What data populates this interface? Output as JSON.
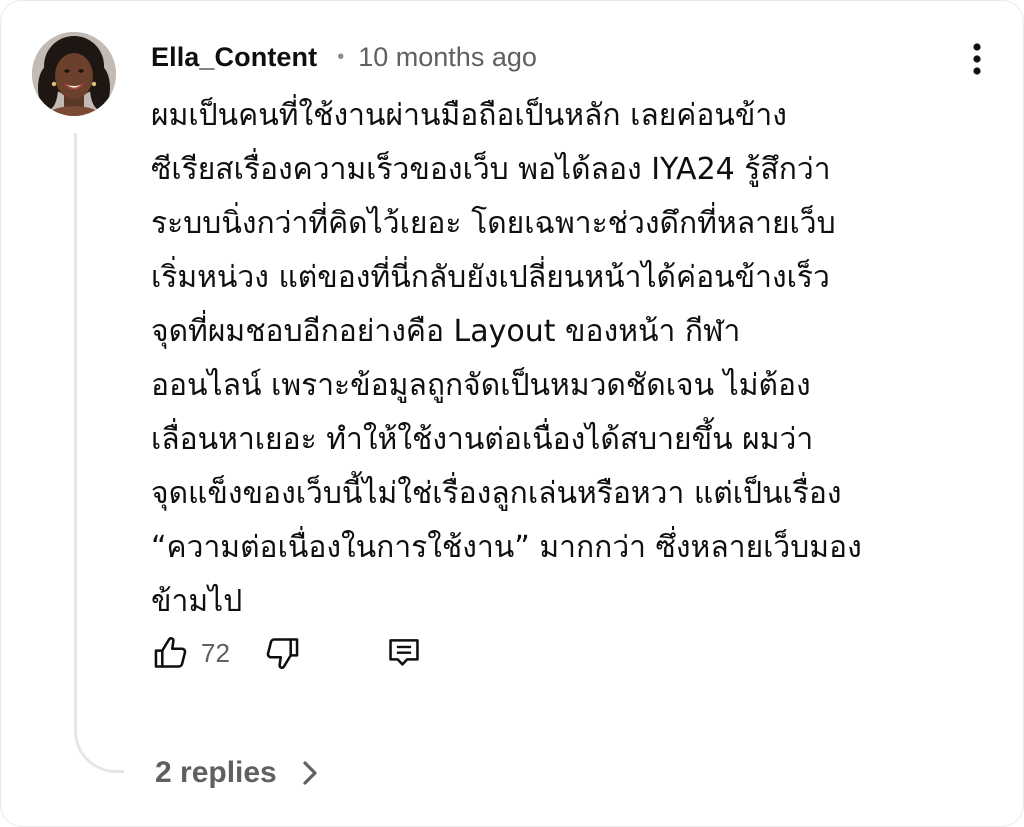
{
  "comment": {
    "author": "Ella_Content",
    "separator": "•",
    "timestamp": "10 months ago",
    "text": "ผมเป็นคนที่ใช้งานผ่านมือถือเป็นหลัก เลยค่อนข้าง\nซีเรียสเรื่องความเร็วของเว็บ พอได้ลอง IYA24 รู้สึกว่า\nระบบนิ่งกว่าที่คิดไว้เยอะ โดยเฉพาะช่วงดึกที่หลายเว็บ\nเริ่มหน่วง แต่ของที่นี่กลับยังเปลี่ยนหน้าได้ค่อนข้างเร็ว\nจุดที่ผมชอบอีกอย่างคือ Layout ของหน้า กีฬา\nออนไลน์ เพราะข้อมูลถูกจัดเป็นหมวดชัดเจน ไม่ต้อง\nเลื่อนหาเยอะ ทำให้ใช้งานต่อเนื่องได้สบายขึ้น ผมว่า\nจุดแข็งของเว็บนี้ไม่ใช่เรื่องลูกเล่นหรือหวา แต่เป็นเรื่อง\n“ความต่อเนื่องในการใช้งาน” มากกว่า ซึ่งหลายเว็บมอง\nข้ามไป",
    "like_count": "72",
    "replies_label": "2 replies"
  },
  "icons": {
    "menu": "more-vertical-icon",
    "like": "thumbs-up-icon",
    "dislike": "thumbs-down-icon",
    "reply": "comment-reply-icon",
    "expand": "chevron-right-icon"
  },
  "colors": {
    "text_primary": "#0f0f0f",
    "text_secondary": "#606060",
    "thread_line": "#e6e6e6"
  }
}
